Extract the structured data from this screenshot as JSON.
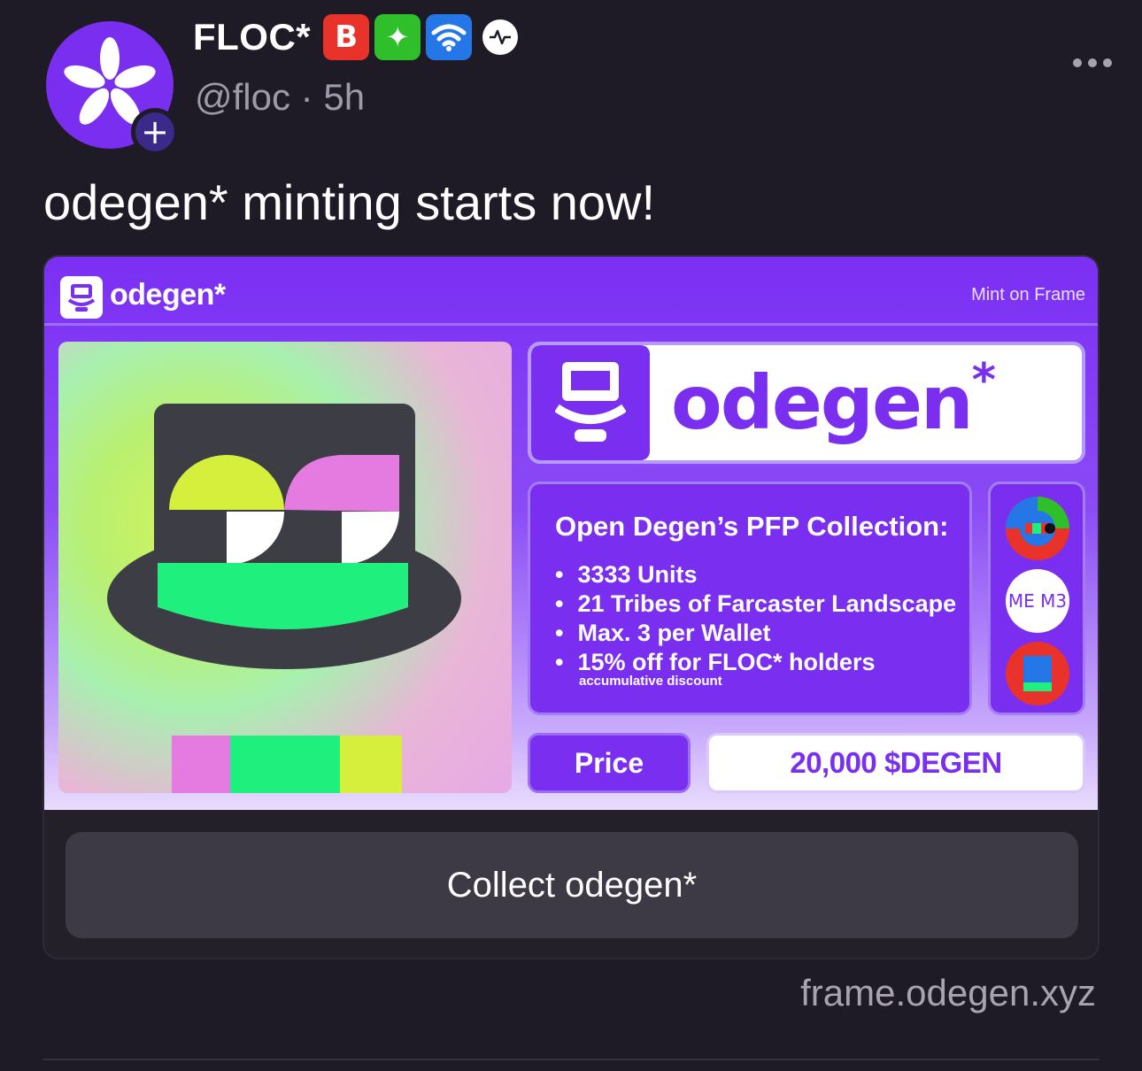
{
  "post": {
    "author": {
      "display_name": "FLOC*",
      "badges": [
        "B",
        "✦",
        "wifi-icon"
      ],
      "handle": "@floc",
      "separator": "·",
      "time_ago": "5h",
      "follow_symbol": "+"
    },
    "text": "odegen* minting starts now!",
    "frame": {
      "header_logo_text": "odegen*",
      "header_right": "Mint on Frame",
      "title": "odegen",
      "title_asterisk": "*",
      "collection_heading": "Open Degen’s PFP Collection:",
      "features": [
        "3333 Units",
        "21 Tribes of Farcaster Landscape",
        "Max. 3 per Wallet",
        "15% off for FLOC* holders"
      ],
      "features_note": "accumulative discount",
      "partner_icons": [
        "tribe-icon",
        "memes-icon",
        "square-icon"
      ],
      "partner_text": "ME M3",
      "price_label": "Price",
      "price_value": "20,000 $DEGEN",
      "button_label": "Collect odegen*"
    },
    "frame_url": "frame.odegen.xyz"
  },
  "colors": {
    "background": "#1e1a26",
    "accent_purple": "#7a2ff0",
    "muted_text": "#a09aa8",
    "button_bg": "#3d3a45"
  }
}
